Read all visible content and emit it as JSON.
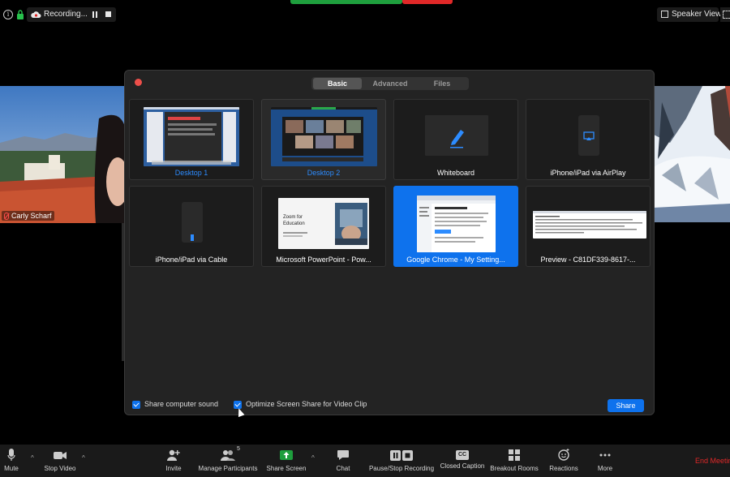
{
  "top": {
    "recording_label": "Recording...",
    "view_label": "Speaker View"
  },
  "participants": {
    "left_name": "Carly Scharf"
  },
  "dialog": {
    "tabs": [
      {
        "label": "Basic"
      },
      {
        "label": "Advanced"
      },
      {
        "label": "Files"
      }
    ],
    "sources": [
      {
        "label": "Desktop 1"
      },
      {
        "label": "Desktop 2"
      },
      {
        "label": "Whiteboard"
      },
      {
        "label": "iPhone/iPad via AirPlay"
      },
      {
        "label": "iPhone/iPad via Cable"
      },
      {
        "label": "Microsoft PowerPoint - Pow..."
      },
      {
        "label": "Google Chrome - My Setting..."
      },
      {
        "label": "Preview - C81DF339-8617-..."
      }
    ],
    "ppt_thumb_title": "Zoom for Education",
    "share_sound_label": "Share computer sound",
    "optimize_label": "Optimize Screen Share for Video Clip",
    "share_button": "Share"
  },
  "toolbar": {
    "mute": "Mute",
    "stop_video": "Stop Video",
    "invite": "Invite",
    "manage_participants": "Manage Participants",
    "participant_count": "5",
    "share_screen": "Share Screen",
    "chat": "Chat",
    "pause_recording": "Pause/Stop Recording",
    "closed_caption": "Closed Caption",
    "cc_badge": "CC",
    "breakout_rooms": "Breakout Rooms",
    "reactions": "Reactions",
    "more": "More",
    "end_meeting": "End Meetin"
  },
  "colors": {
    "accent_blue": "#0e72ed",
    "end_red": "#e02828",
    "close_dot": "#ed4f4a",
    "share_green": "#1e9e3d"
  },
  "icons": [
    "info-icon",
    "lock-icon",
    "cloud-icon",
    "pause-icon",
    "stop-icon",
    "grid-icon",
    "pencil-icon",
    "airplay-icon",
    "phone-icon",
    "mic-icon",
    "camera-icon",
    "add-person-icon",
    "participants-icon",
    "share-arrow-icon",
    "chat-icon",
    "record-icon",
    "cc-icon",
    "breakout-icon",
    "reactions-icon",
    "more-icon"
  ]
}
